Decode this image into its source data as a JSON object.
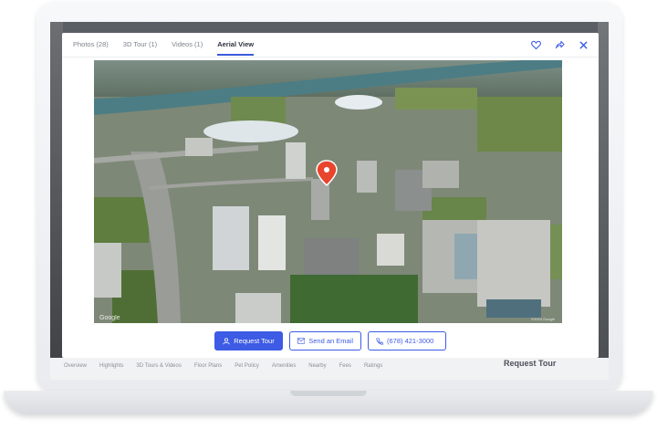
{
  "tabs": [
    {
      "label": "Photos (28)"
    },
    {
      "label": "3D Tour (1)"
    },
    {
      "label": "Videos (1)"
    },
    {
      "label": "Aerial View"
    }
  ],
  "active_tab": "Aerial View",
  "icons": [
    "heart-icon",
    "share-icon",
    "close-icon"
  ],
  "map": {
    "credit_left": "Google",
    "credit_right": "©2023 Google"
  },
  "actions": {
    "request_tour": "Request Tour",
    "send_email": "Send an Email",
    "phone": "(678) 421-3000"
  },
  "background_page": {
    "nav_items": [
      "Overview",
      "Highlights",
      "3D Tours & Videos",
      "Floor Plans",
      "Pet Policy",
      "Amenities",
      "Nearby",
      "Fees",
      "Ratings"
    ],
    "cta": "Request Tour"
  },
  "colors": {
    "accent": "#3d5be4"
  }
}
